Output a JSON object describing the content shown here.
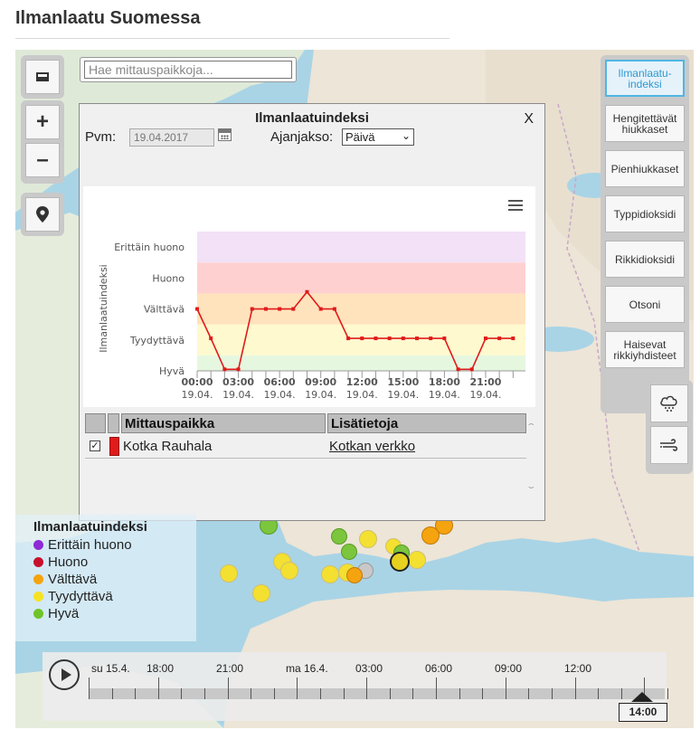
{
  "page": {
    "title": "Ilmanlaatu Suomessa"
  },
  "search": {
    "placeholder": "Hae mittauspaikkoja..."
  },
  "map_controls": {
    "fullscreen_icon": "fullscreen-icon",
    "zoom_in": "+",
    "zoom_out": "–",
    "locate_icon": "map-marker-icon"
  },
  "layers": [
    {
      "label": "Ilmanlaatu-indeksi",
      "active": true
    },
    {
      "label": "Hengitettävät hiukkaset",
      "active": false
    },
    {
      "label": "Pienhiukkaset",
      "active": false
    },
    {
      "label": "Typpidioksidi",
      "active": false
    },
    {
      "label": "Rikkidioksidi",
      "active": false
    },
    {
      "label": "Otsoni",
      "active": false
    },
    {
      "label": "Haisevat rikkiyhdisteet",
      "active": false
    }
  ],
  "side_icons": [
    "rain-cloud-icon",
    "wind-icon"
  ],
  "popup": {
    "title": "Ilmanlaatuindeksi",
    "close": "X",
    "date_label": "Pvm:",
    "date_value": "19.04.2017",
    "period_label": "Ajanjakso:",
    "period_value": "Päivä",
    "table": {
      "headers": [
        "Mittauspaikka",
        "Lisätietoja"
      ],
      "rows": [
        {
          "checked": true,
          "color": "#e01b1b",
          "place": "Kotka Rauhala",
          "info": "Kotkan verkko"
        }
      ]
    }
  },
  "chart_data": {
    "type": "line",
    "ylabel": "Ilmanlaatuindeksi",
    "y_categories": [
      "Hyvä",
      "Tyydyttävä",
      "Välttävä",
      "Huono",
      "Erittäin huono"
    ],
    "band_colors": [
      "#e6f7e0",
      "#fff9cf",
      "#ffe3bd",
      "#ffd0d0",
      "#f2e1f7"
    ],
    "x_ticks": [
      {
        "time": "00:00",
        "date": "19.04."
      },
      {
        "time": "03:00",
        "date": "19.04."
      },
      {
        "time": "06:00",
        "date": "19.04."
      },
      {
        "time": "09:00",
        "date": "19.04."
      },
      {
        "time": "12:00",
        "date": "19.04."
      },
      {
        "time": "15:00",
        "date": "19.04."
      },
      {
        "time": "18:00",
        "date": "19.04."
      },
      {
        "time": "21:00",
        "date": "19.04."
      }
    ],
    "x_hours": [
      0,
      1,
      2,
      3,
      4,
      5,
      6,
      7,
      8,
      9,
      10,
      11,
      12,
      13,
      14,
      15,
      16,
      17,
      18,
      19,
      20,
      21,
      22,
      23
    ],
    "values": [
      3,
      2.05,
      1.05,
      1.05,
      3,
      3,
      3,
      3,
      3.55,
      3,
      3,
      2.05,
      2.05,
      2.05,
      2.05,
      2.05,
      2.05,
      2.05,
      2.05,
      1.05,
      1.05,
      2.05,
      2.05,
      2.05
    ],
    "series": [
      {
        "color": "#e01b1b"
      }
    ]
  },
  "legend": {
    "title": "Ilmanlaatuindeksi",
    "items": [
      {
        "label": "Erittäin huono",
        "color": "#8e2ad6"
      },
      {
        "label": "Huono",
        "color": "#c8102e"
      },
      {
        "label": "Välttävä",
        "color": "#f5a30f"
      },
      {
        "label": "Tyydyttävä",
        "color": "#f5e322"
      },
      {
        "label": "Hyvä",
        "color": "#6ec428"
      }
    ]
  },
  "timeline": {
    "labels": [
      "su 15.4.",
      "18:00",
      "21:00",
      "ma 16.4.",
      "03:00",
      "06:00",
      "09:00",
      "12:00"
    ],
    "current": "14:00"
  }
}
